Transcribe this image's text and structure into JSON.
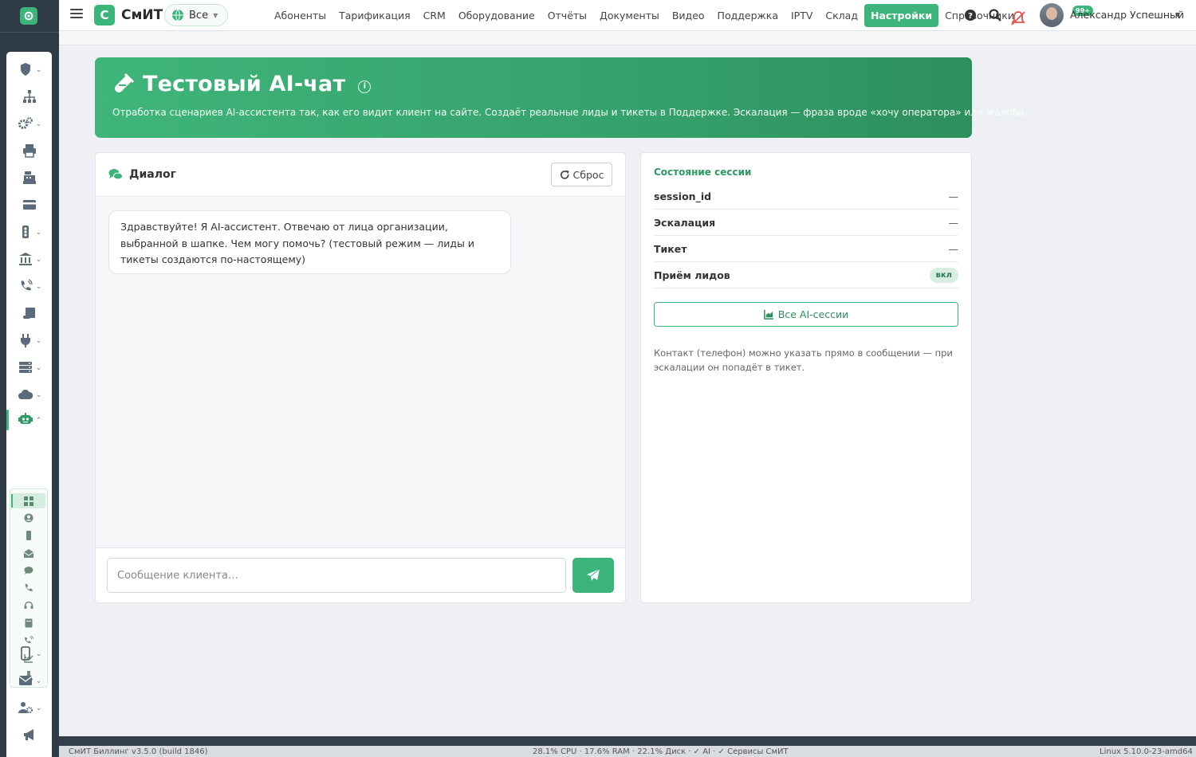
{
  "app": {
    "brand_letter": "С",
    "brand_name": "СмИТ"
  },
  "org_select": {
    "value": "Все"
  },
  "menu": [
    {
      "label": "Абоненты",
      "active": false
    },
    {
      "label": "Тарификация",
      "active": false
    },
    {
      "label": "CRM",
      "active": false
    },
    {
      "label": "Оборудование",
      "active": false
    },
    {
      "label": "Отчёты",
      "active": false
    },
    {
      "label": "Документы",
      "active": false
    },
    {
      "label": "Видео",
      "active": false
    },
    {
      "label": "Поддержка",
      "active": false
    },
    {
      "label": "IPTV",
      "active": false
    },
    {
      "label": "Склад",
      "active": false
    },
    {
      "label": "Настройки",
      "active": true
    },
    {
      "label": "Справочники",
      "active": false
    }
  ],
  "notifications": {
    "badge": "99+"
  },
  "user": {
    "name": "Александр Успешный"
  },
  "sidebar": {
    "icons": [
      "shield-icon",
      "sitemap-icon",
      "gears-icon",
      "printer-icon",
      "cash-register-icon",
      "credit-card-icon",
      "traffic-light-icon",
      "bank-icon",
      "phone-volume-icon",
      "scroll-icon",
      "plug-icon",
      "server-icon",
      "cloud-icon",
      "robot-icon",
      "mobile-icon",
      "envelope-icon",
      "users-cog-icon",
      "bullhorn-icon"
    ],
    "active": "robot-icon",
    "sub_icons": [
      "dashboard-icon",
      "user-circle-icon",
      "mobile-icon",
      "envelope-open-icon",
      "comment-icon",
      "phone-icon",
      "headset-icon",
      "book-icon",
      "phone-volume-icon",
      "chart-line-icon",
      "flask-icon"
    ]
  },
  "hero": {
    "title": "Тестовый AI-чат",
    "subtitle": "Отработка сценариев AI-ассистента так, как его видит клиент на сайте. Создаёт реальные лиды и тикеты в Поддержке. Эскалация — фраза вроде «хочу оператора» или жалоба."
  },
  "chat": {
    "title": "Диалог",
    "reset_label": "Сброс",
    "messages": [
      {
        "from": "assistant",
        "text": "Здравствуйте! Я AI-ассистент. Отвечаю от лица организации, выбранной в шапке. Чем могу помочь? (тестовый режим — лиды и тикеты создаются по-настоящему)"
      }
    ],
    "input_placeholder": "Сообщение клиента…"
  },
  "session": {
    "title": "Состояние сессии",
    "rows": [
      {
        "key": "session_id",
        "value": "—"
      },
      {
        "key": "Эскалация",
        "value": "—"
      },
      {
        "key": "Тикет",
        "value": "—"
      },
      {
        "key": "Приём лидов",
        "value": "вкл"
      }
    ],
    "all_sessions_label": "Все AI-сессии",
    "note": "Контакт (телефон) можно указать прямо в сообщении — при эскалации он попадёт в тикет."
  },
  "footer": {
    "left": "СмИТ Биллинг v3.5.0 (build 1846)",
    "center": "28.1% CPU · 17.6% RAM · 22.1% Диск · ✓ AI · ✓ Сервисы СмИТ",
    "right": "Linux 5.10.0-23-amd64"
  },
  "colors": {
    "accent": "#3bb57a",
    "sidebar_dark": "#2e3a46",
    "footer_dark": "#333f4b"
  }
}
